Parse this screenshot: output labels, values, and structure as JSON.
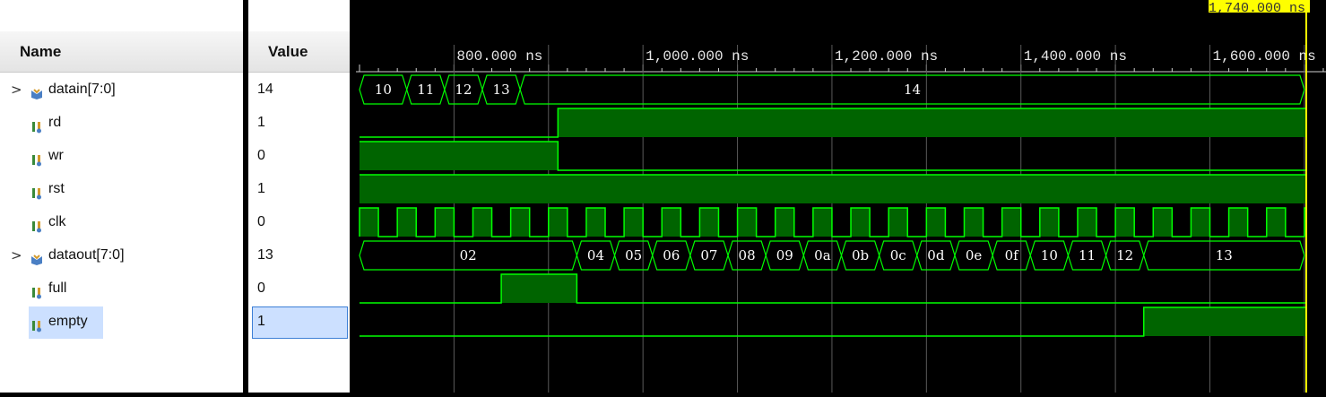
{
  "names_panel": {
    "header": "Name"
  },
  "values_panel": {
    "header": "Value"
  },
  "signals": [
    {
      "name": "datain[7:0]",
      "value": "14",
      "kind": "bus",
      "expandable": true,
      "icon": "bus-icon"
    },
    {
      "name": "rd",
      "value": "1",
      "kind": "bit",
      "expandable": false,
      "icon": "signal-icon"
    },
    {
      "name": "wr",
      "value": "0",
      "kind": "bit",
      "expandable": false,
      "icon": "signal-icon"
    },
    {
      "name": "rst",
      "value": "1",
      "kind": "bit",
      "expandable": false,
      "icon": "signal-icon"
    },
    {
      "name": "clk",
      "value": "0",
      "kind": "bit",
      "expandable": false,
      "icon": "signal-icon"
    },
    {
      "name": "dataout[7:0]",
      "value": "13",
      "kind": "bus",
      "expandable": true,
      "icon": "bus-icon"
    },
    {
      "name": "full",
      "value": "0",
      "kind": "bit",
      "expandable": false,
      "icon": "signal-icon"
    },
    {
      "name": "empty",
      "value": "1",
      "kind": "bit",
      "expandable": false,
      "icon": "signal-icon",
      "selected": true
    }
  ],
  "timeline": {
    "cursor_label": "1,740.000 ns",
    "cursor_time_ns": 1740,
    "view_start_ns": 700,
    "view_end_ns": 1702,
    "tick_labels": [
      {
        "label": "800.000 ns",
        "t": 800
      },
      {
        "label": "1,000.000 ns",
        "t": 1000
      },
      {
        "label": "1,200.000 ns",
        "t": 1200
      },
      {
        "label": "1,400.000 ns",
        "t": 1400
      },
      {
        "label": "1,600.000 ns",
        "t": 1600
      }
    ],
    "grid_times_ns": [
      800,
      900,
      1000,
      1100,
      1200,
      1300,
      1400,
      1500,
      1600,
      1700
    ]
  },
  "waveforms": {
    "datain": [
      {
        "start": 700,
        "end": 700,
        "value": ""
      },
      {
        "start": 700,
        "end": 750,
        "value": "10"
      },
      {
        "start": 750,
        "end": 790,
        "value": "11"
      },
      {
        "start": 790,
        "end": 830,
        "value": "12"
      },
      {
        "start": 830,
        "end": 870,
        "value": "13"
      },
      {
        "start": 870,
        "end": 1700,
        "value": "14"
      }
    ],
    "rd": {
      "initial": 0,
      "transitions": [
        [
          910,
          1
        ]
      ]
    },
    "wr": {
      "initial": 1,
      "transitions": [
        [
          910,
          0
        ]
      ]
    },
    "rst": {
      "initial": 1,
      "transitions": []
    },
    "clk": {
      "first_rise": 700,
      "period": 40,
      "high": 20
    },
    "dataout": [
      {
        "start": 700,
        "end": 930,
        "value": "02"
      },
      {
        "start": 930,
        "end": 970,
        "value": "04"
      },
      {
        "start": 970,
        "end": 1010,
        "value": "05"
      },
      {
        "start": 1010,
        "end": 1050,
        "value": "06"
      },
      {
        "start": 1050,
        "end": 1090,
        "value": "07"
      },
      {
        "start": 1090,
        "end": 1130,
        "value": "08"
      },
      {
        "start": 1130,
        "end": 1170,
        "value": "09"
      },
      {
        "start": 1170,
        "end": 1210,
        "value": "0a"
      },
      {
        "start": 1210,
        "end": 1250,
        "value": "0b"
      },
      {
        "start": 1250,
        "end": 1290,
        "value": "0c"
      },
      {
        "start": 1290,
        "end": 1330,
        "value": "0d"
      },
      {
        "start": 1330,
        "end": 1370,
        "value": "0e"
      },
      {
        "start": 1370,
        "end": 1410,
        "value": "0f"
      },
      {
        "start": 1410,
        "end": 1450,
        "value": "10"
      },
      {
        "start": 1450,
        "end": 1490,
        "value": "11"
      },
      {
        "start": 1490,
        "end": 1530,
        "value": "12"
      },
      {
        "start": 1530,
        "end": 1700,
        "value": "13"
      }
    ],
    "full": {
      "initial": 0,
      "transitions": [
        [
          850,
          1
        ],
        [
          930,
          0
        ]
      ]
    },
    "empty": {
      "initial": 0,
      "transitions": [
        [
          1530,
          1
        ]
      ]
    }
  },
  "colors": {
    "wave": "#00ff00",
    "wave_fill": "#006400",
    "grid": "#5a5a5a",
    "cursor": "#ffff00",
    "selection": "#cce0ff"
  }
}
